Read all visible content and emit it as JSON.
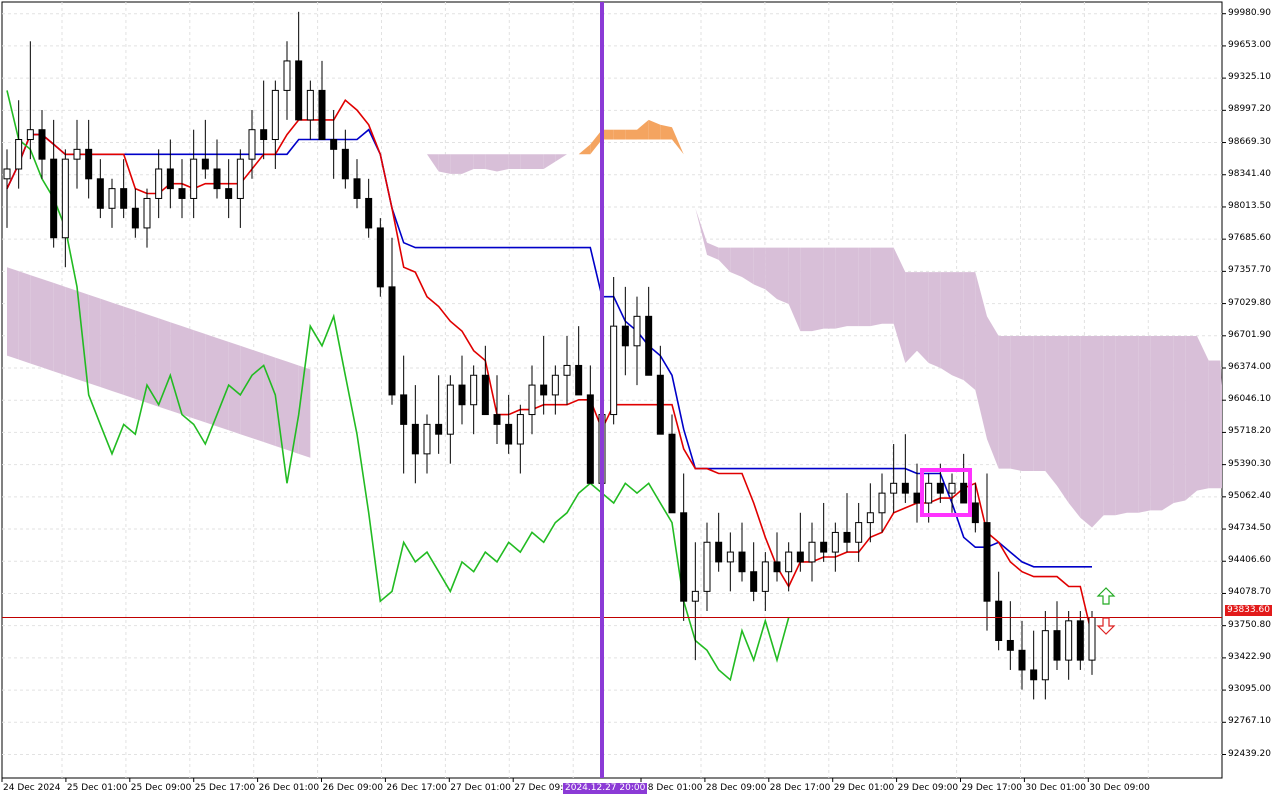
{
  "chart_data": {
    "type": "candlestick",
    "indicator": "Ichimoku Kinko Hyo",
    "y_axis": {
      "ylim": [
        92200,
        100100
      ],
      "ticks": [
        "99980.90",
        "99653.00",
        "99325.10",
        "98997.20",
        "98669.30",
        "98341.40",
        "98013.50",
        "97685.60",
        "97357.70",
        "97029.80",
        "96701.90",
        "96374.00",
        "96046.10",
        "95718.20",
        "95390.30",
        "95062.40",
        "94734.50",
        "94406.60",
        "94078.70",
        "93750.80",
        "93422.90",
        "93095.00",
        "92767.10",
        "92439.20"
      ]
    },
    "x_axis": {
      "ticks": [
        "24 Dec 2024",
        "25 Dec 01:00",
        "25 Dec 09:00",
        "25 Dec 17:00",
        "26 Dec 01:00",
        "26 Dec 09:00",
        "26 Dec 17:00",
        "27 Dec 01:00",
        "27 Dec 09:00",
        "28 Dec 01:00",
        "28 Dec 09:00",
        "28 Dec 17:00",
        "29 Dec 01:00",
        "29 Dec 09:00",
        "29 Dec 17:00",
        "30 Dec 01:00",
        "30 Dec 09:00"
      ]
    },
    "current_price": "93833.60",
    "vertical_marker": {
      "label": "2024.12.27 20:00",
      "color": "#8b3ad6"
    },
    "colors": {
      "tenkan": "#e00000",
      "kijun": "#0000c8",
      "chikou": "#22bb22",
      "kumo_bull": "#f4a460",
      "kumo_bear": "#d8bfd8",
      "bull_candle": "#ffffff",
      "bear_candle": "#000000",
      "price_line": "#c00000",
      "highlight_box": "#ff33ff"
    },
    "signals": {
      "buy_arrow": "up-arrow-icon",
      "sell_arrow": "down-arrow-icon"
    },
    "grid": true,
    "legend": "none",
    "candles": [
      [
        98300,
        98600,
        97800,
        98400
      ],
      [
        98400,
        99100,
        98200,
        98700
      ],
      [
        98700,
        99700,
        98500,
        98800
      ],
      [
        98800,
        99000,
        98300,
        98500
      ],
      [
        98500,
        98900,
        97600,
        97700
      ],
      [
        97700,
        98600,
        97400,
        98500
      ],
      [
        98500,
        98900,
        98200,
        98600
      ],
      [
        98600,
        98900,
        98100,
        98300
      ],
      [
        98300,
        98500,
        97900,
        98000
      ],
      [
        98000,
        98300,
        97800,
        98200
      ],
      [
        98200,
        98500,
        97900,
        98000
      ],
      [
        98000,
        98200,
        97700,
        97800
      ],
      [
        97800,
        98200,
        97600,
        98100
      ],
      [
        98100,
        98600,
        97900,
        98400
      ],
      [
        98400,
        98700,
        98000,
        98200
      ],
      [
        98200,
        98500,
        97900,
        98100
      ],
      [
        98100,
        98800,
        97900,
        98500
      ],
      [
        98500,
        98900,
        98300,
        98400
      ],
      [
        98400,
        98700,
        98100,
        98200
      ],
      [
        98200,
        98500,
        97900,
        98100
      ],
      [
        98100,
        98600,
        97800,
        98500
      ],
      [
        98500,
        99000,
        98300,
        98800
      ],
      [
        98800,
        99300,
        98500,
        98700
      ],
      [
        98700,
        99300,
        98400,
        99200
      ],
      [
        99200,
        99700,
        98900,
        99500
      ],
      [
        99500,
        100000,
        99000,
        98900
      ],
      [
        98900,
        99300,
        98700,
        99200
      ],
      [
        99200,
        99500,
        98800,
        98700
      ],
      [
        98700,
        99000,
        98300,
        98600
      ],
      [
        98600,
        98800,
        98200,
        98300
      ],
      [
        98300,
        98500,
        98000,
        98100
      ],
      [
        98100,
        98300,
        97700,
        97800
      ],
      [
        97800,
        97900,
        97100,
        97200
      ],
      [
        97200,
        97700,
        96000,
        96100
      ],
      [
        96100,
        96500,
        95300,
        95800
      ],
      [
        95800,
        96200,
        95200,
        95500
      ],
      [
        95500,
        95900,
        95300,
        95800
      ],
      [
        95800,
        96300,
        95500,
        95700
      ],
      [
        95700,
        96300,
        95400,
        96200
      ],
      [
        96200,
        96500,
        95800,
        96000
      ],
      [
        96000,
        96400,
        95700,
        96300
      ],
      [
        96300,
        96600,
        96000,
        95900
      ],
      [
        95900,
        96300,
        95600,
        95800
      ],
      [
        95800,
        96100,
        95500,
        95600
      ],
      [
        95600,
        96000,
        95300,
        95900
      ],
      [
        95900,
        96400,
        95700,
        96200
      ],
      [
        96200,
        96700,
        95900,
        96100
      ],
      [
        96100,
        96400,
        95900,
        96300
      ],
      [
        96300,
        96700,
        96000,
        96400
      ],
      [
        96400,
        96800,
        96200,
        96100
      ],
      [
        96100,
        96400,
        95700,
        95200
      ],
      [
        95200,
        95800,
        94700,
        95900
      ],
      [
        95900,
        97300,
        95800,
        96800
      ],
      [
        96800,
        97200,
        96300,
        96600
      ],
      [
        96600,
        97100,
        96200,
        96900
      ],
      [
        96900,
        97200,
        96400,
        96300
      ],
      [
        96300,
        96600,
        95700,
        95700
      ],
      [
        95700,
        95900,
        94900,
        94900
      ],
      [
        94900,
        95300,
        93800,
        94000
      ],
      [
        94000,
        94600,
        93400,
        94100
      ],
      [
        94100,
        94800,
        93900,
        94600
      ],
      [
        94600,
        94900,
        94300,
        94400
      ],
      [
        94400,
        94700,
        94100,
        94500
      ],
      [
        94500,
        94800,
        94200,
        94300
      ],
      [
        94300,
        94600,
        94000,
        94100
      ],
      [
        94100,
        94500,
        93900,
        94400
      ],
      [
        94400,
        94700,
        94200,
        94300
      ],
      [
        94300,
        94600,
        94100,
        94500
      ],
      [
        94500,
        94900,
        94300,
        94400
      ],
      [
        94400,
        94800,
        94200,
        94600
      ],
      [
        94600,
        95000,
        94400,
        94500
      ],
      [
        94500,
        94800,
        94300,
        94700
      ],
      [
        94700,
        95100,
        94500,
        94600
      ],
      [
        94600,
        95000,
        94400,
        94800
      ],
      [
        94800,
        95200,
        94600,
        94900
      ],
      [
        94900,
        95300,
        94700,
        95100
      ],
      [
        95100,
        95600,
        94900,
        95200
      ],
      [
        95200,
        95700,
        95000,
        95100
      ],
      [
        95100,
        95400,
        94800,
        95000
      ],
      [
        95000,
        95300,
        94800,
        95200
      ],
      [
        95200,
        95400,
        95000,
        95100
      ],
      [
        95100,
        95300,
        94900,
        95200
      ],
      [
        95200,
        95500,
        95000,
        95000
      ],
      [
        95000,
        95200,
        94700,
        94800
      ],
      [
        94800,
        95300,
        93700,
        94000
      ],
      [
        94000,
        94300,
        93500,
        93600
      ],
      [
        93600,
        94000,
        93300,
        93500
      ],
      [
        93500,
        93800,
        93100,
        93300
      ],
      [
        93300,
        93700,
        93000,
        93200
      ],
      [
        93200,
        93900,
        93000,
        93700
      ],
      [
        93700,
        94000,
        93300,
        93400
      ],
      [
        93400,
        93900,
        93200,
        93800
      ],
      [
        93800,
        93900,
        93300,
        93400
      ],
      [
        93400,
        93900,
        93250,
        93834
      ]
    ]
  }
}
